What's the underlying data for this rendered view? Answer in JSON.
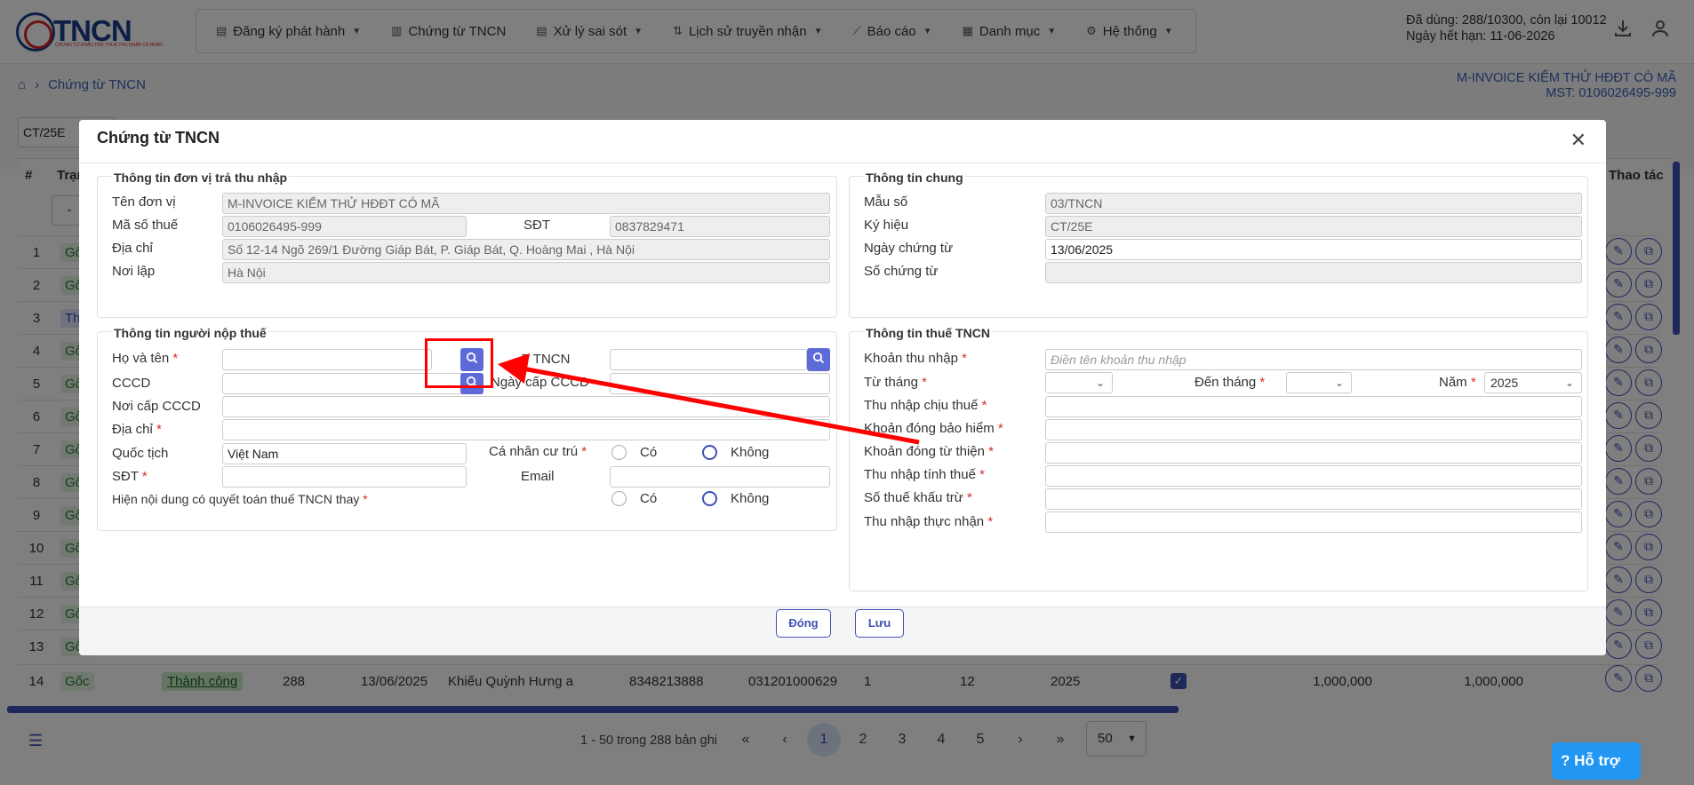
{
  "header": {
    "logo_text": "TNCN",
    "logo_sub": "CHỨNG TỪ KHẤU TRỪ THUẾ THU NHẬP CÁ NHÂN",
    "menu": [
      {
        "label": "Đăng ký phát hành",
        "icon": "file-icon",
        "dropdown": true
      },
      {
        "label": "Chứng từ TNCN",
        "icon": "document-icon",
        "dropdown": false
      },
      {
        "label": "Xử lý sai sót",
        "icon": "file-edit-icon",
        "dropdown": true
      },
      {
        "label": "Lịch sử truyền nhận",
        "icon": "sort-icon",
        "dropdown": true
      },
      {
        "label": "Báo cáo",
        "icon": "chart-icon",
        "dropdown": true
      },
      {
        "label": "Danh mục",
        "icon": "grid-icon",
        "dropdown": true
      },
      {
        "label": "Hệ thống",
        "icon": "gear-icon",
        "dropdown": true
      }
    ],
    "usage_line1": "Đã dùng: 288/10300, còn lại 10012",
    "usage_line2": "Ngày hết hạn: 11-06-2026"
  },
  "breadcrumb": {
    "current": "Chứng từ TNCN"
  },
  "company": {
    "name": "M-INVOICE KIỂM THỬ HĐĐT CÓ MÃ",
    "mst": "MST: 0106026495-999"
  },
  "background_table": {
    "filter_value": "CT/25E",
    "header_hash": "#",
    "header_status": "Trạng",
    "header_actions": "Thao tác",
    "filter_dash": "-",
    "row_numbers": [
      "1",
      "2",
      "3",
      "4",
      "5",
      "6",
      "7",
      "8",
      "9",
      "10",
      "11",
      "12",
      "13",
      "14"
    ],
    "row_badges": [
      "Gốc",
      "Gốc",
      "Tha",
      "Gốc",
      "Gốc",
      "Gốc",
      "Gốc",
      "Gốc",
      "Gốc",
      "Gốc",
      "Gốc",
      "Gốc",
      "Gốc",
      "Gốc"
    ],
    "row14": {
      "no": "14",
      "type": "Gốc",
      "status": "Thành công",
      "number": "288",
      "date": "13/06/2025",
      "name": "Khiếu Quỳnh Hưng a",
      "tax_code": "8348213888",
      "cccd": "031201000629",
      "from": "1",
      "to": "12",
      "year": "2025",
      "amount1": "1,000,000",
      "amount2": "1,000,000"
    }
  },
  "pagination": {
    "summary": "1 - 50 trong 288 bản ghi",
    "pages": [
      "1",
      "2",
      "3",
      "4",
      "5"
    ],
    "active": "1",
    "page_size": "50"
  },
  "support_label": "Hỗ trợ",
  "modal": {
    "title": "Chứng từ TNCN",
    "payer_section": {
      "title": "Thông tin đơn vị trả thu nhập",
      "name_label": "Tên đơn vị",
      "name_value": "M-INVOICE KIỂM THỬ HĐĐT CÓ MÃ",
      "tax_label": "Mã số thuế",
      "tax_value": "0106026495-999",
      "phone_label": "SĐT",
      "phone_value": "0837829471",
      "address_label": "Địa chỉ",
      "address_value": "Số 12-14 Ngõ 269/1 Đường Giáp Bát, P. Giáp Bát, Q. Hoàng Mai , Hà Nội",
      "place_label": "Nơi lập",
      "place_value": "Hà Nội"
    },
    "general_section": {
      "title": "Thông tin chung",
      "form_label": "Mẫu số",
      "form_value": "03/TNCN",
      "symbol_label": "Ký hiệu",
      "symbol_value": "CT/25E",
      "date_label": "Ngày chứng từ",
      "date_value": "13/06/2025",
      "number_label": "Số chứng từ",
      "number_value": ""
    },
    "taxpayer_section": {
      "title": "Thông tin người nộp thuế",
      "fullname_label": "Họ và tên",
      "taxcode_label": "MST TNCN",
      "taxcode_label_visible": "T TNCN",
      "cccd_label": "CCCD",
      "cccd_date_label": "Ngày cấp CCCD",
      "cccd_place_label": "Nơi cấp CCCD",
      "address_label": "Địa chỉ",
      "nationality_label": "Quốc tịch",
      "nationality_value": "Việt Nam",
      "resident_label": "Cá nhân cư trú",
      "phone_label": "SĐT",
      "email_label": "Email",
      "settlement_label": "Hiện nội dung có quyết toán thuế TNCN thay",
      "yes_label": "Có",
      "no_label": "Không"
    },
    "tax_section": {
      "title": "Thông tin thuế TNCN",
      "income_item_label": "Khoản thu nhập",
      "income_item_placeholder": "Điền tên khoản thu nhập",
      "from_month_label": "Từ tháng",
      "to_month_label": "Đến tháng",
      "year_label": "Năm",
      "year_value": "2025",
      "taxable_income_label": "Thu nhập chịu thuế",
      "insurance_label": "Khoản đóng bảo hiểm",
      "charity_label": "Khoản đóng từ thiện",
      "assessable_income_label": "Thu nhập tính thuế",
      "withheld_label": "Số thuế khấu trừ",
      "net_income_label": "Thu nhập thực nhận"
    },
    "close_label": "Đóng",
    "save_label": "Lưu"
  },
  "colors": {
    "primary": "#3f51b5",
    "accent": "#5c6bd7",
    "required": "#d32f2f",
    "annotation": "#ff0000",
    "brand_blue": "#1a3c8f",
    "brand_red": "#d8232a"
  }
}
